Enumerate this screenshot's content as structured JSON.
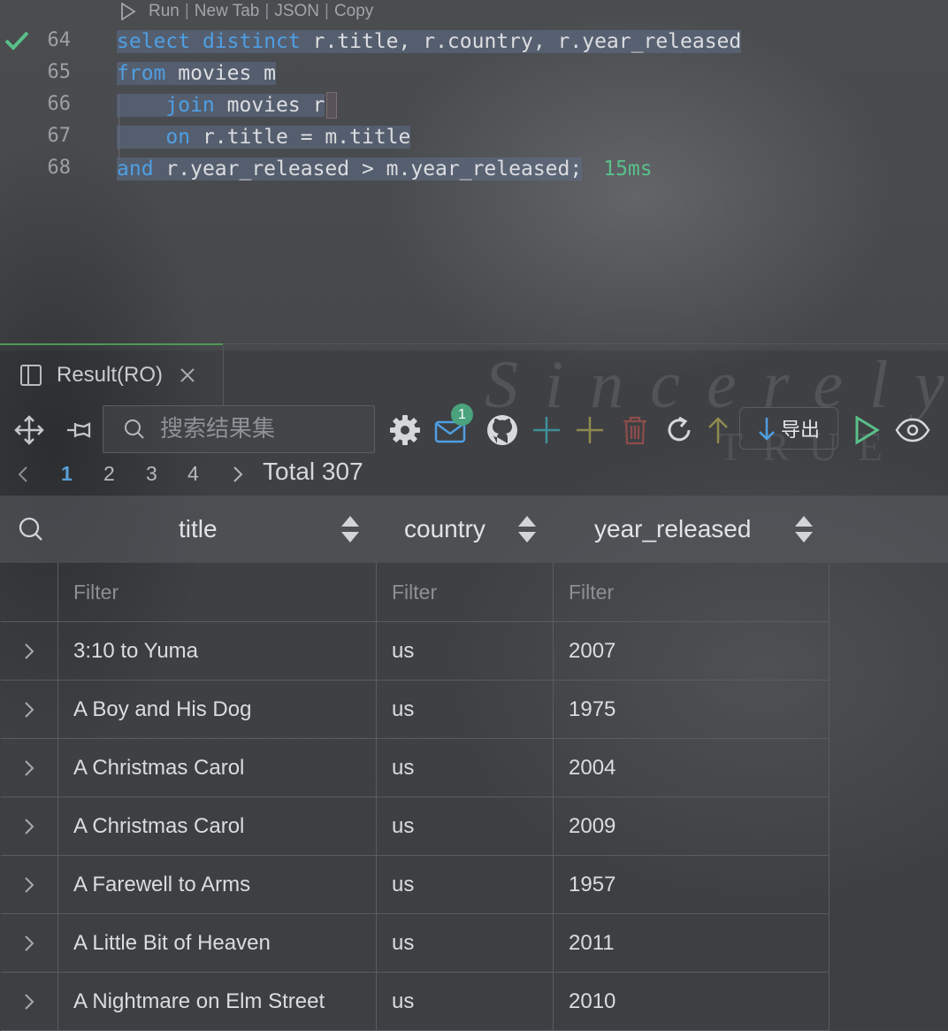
{
  "codelens": {
    "run": "Run",
    "new_tab": "New Tab",
    "json": "JSON",
    "copy": "Copy",
    "separator": "|"
  },
  "editor": {
    "lines": [
      {
        "number": "64",
        "parts": [
          "select",
          "distinct",
          "r.title, r.country, r.year_released"
        ]
      },
      {
        "number": "65",
        "parts": [
          "from",
          "movies m"
        ]
      },
      {
        "number": "66",
        "parts": [
          "join",
          "movies r"
        ]
      },
      {
        "number": "67",
        "parts": [
          "on",
          "r.title = m.title"
        ]
      },
      {
        "number": "68",
        "parts": [
          "and",
          "r.year_released > m.year_released;"
        ]
      }
    ],
    "timing": "15ms"
  },
  "panel": {
    "tab_label": "Result(RO)"
  },
  "toolbar": {
    "search_placeholder": "搜索结果集",
    "notification_count": "1",
    "export_label": "导出"
  },
  "pagination": {
    "pages": [
      "1",
      "2",
      "3",
      "4"
    ],
    "current": "1",
    "total": "Total 307"
  },
  "table": {
    "columns": [
      "title",
      "country",
      "year_released"
    ],
    "filter_placeholder": "Filter",
    "rows": [
      [
        "3:10 to Yuma",
        "us",
        "2007"
      ],
      [
        "A Boy and His Dog",
        "us",
        "1975"
      ],
      [
        "A Christmas Carol",
        "us",
        "2004"
      ],
      [
        "A Christmas Carol",
        "us",
        "2009"
      ],
      [
        "A Farewell to Arms",
        "us",
        "1957"
      ],
      [
        "A Little Bit of Heaven",
        "us",
        "2011"
      ],
      [
        "A Nightmare on Elm Street",
        "us",
        "2010"
      ]
    ]
  },
  "colors": {
    "keyword": "#4f9fe3",
    "success": "#59c08a",
    "accent_blue": "#5aa0d6",
    "badge": "#4aa37d",
    "add_teal": "#3f8f9a",
    "add_olive": "#8f8a4e",
    "delete_red": "#8e4c4c"
  },
  "background_text": [
    "Sincerely",
    "TRUE"
  ]
}
